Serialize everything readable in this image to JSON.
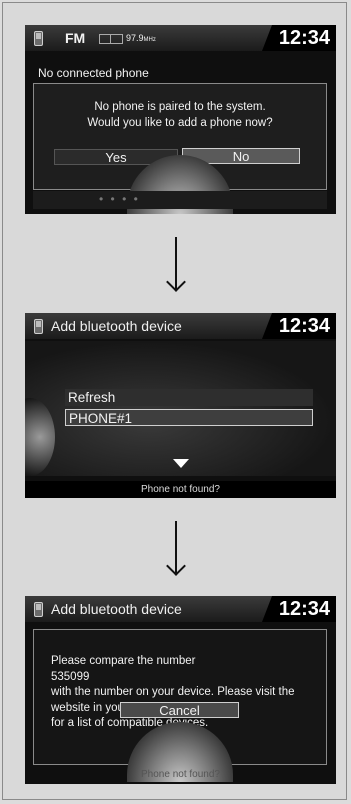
{
  "screen1": {
    "source": "FM",
    "frequency": "97.9",
    "frequency_unit": "MHz",
    "time": "12:34",
    "header_message": "No connected phone",
    "dialog_line1": "No phone is paired to the system.",
    "dialog_line2": "Would you like to add a phone now?",
    "yes_label": "Yes",
    "no_label": "No",
    "footer_dots": "• • • •"
  },
  "screen2": {
    "title": "Add bluetooth device",
    "time": "12:34",
    "items": [
      {
        "label": "Refresh"
      },
      {
        "label": "PHONE#1"
      }
    ],
    "footer": "Phone not found?"
  },
  "screen3": {
    "title": "Add bluetooth device",
    "time": "12:34",
    "message_lines": [
      "Please compare the number",
      "535099",
      "with the number on your device. Please visit the",
      "website in your owner's manual",
      "for a list of compatible devices."
    ],
    "cancel_label": "Cancel",
    "footer": "Phone not found?"
  },
  "icons": {
    "phone": "phone-icon",
    "stereo": "stereo-indicator-icon",
    "arrow": "down-arrow-icon",
    "scroll_indicator": "triangle-down-icon"
  }
}
